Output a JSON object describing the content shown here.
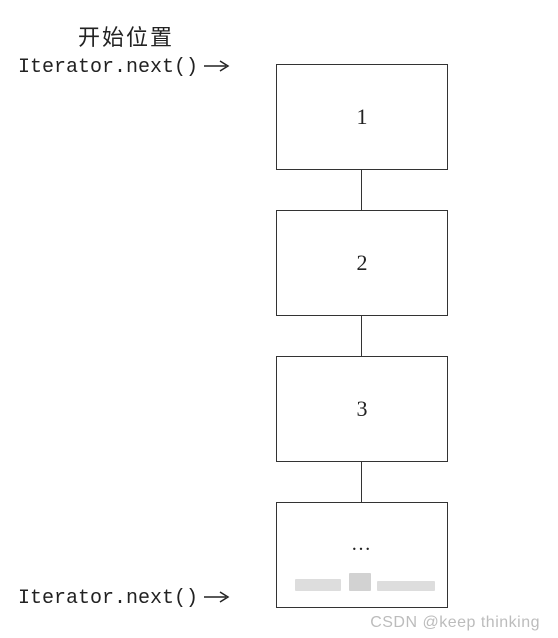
{
  "labels": {
    "start_title": "开始位置",
    "iterator_top": "Iterator.next()",
    "iterator_bottom": "Iterator.next()"
  },
  "boxes": [
    {
      "value": "1"
    },
    {
      "value": "2"
    },
    {
      "value": "3"
    },
    {
      "value": "…"
    }
  ],
  "watermark": "CSDN @keep   thinking"
}
